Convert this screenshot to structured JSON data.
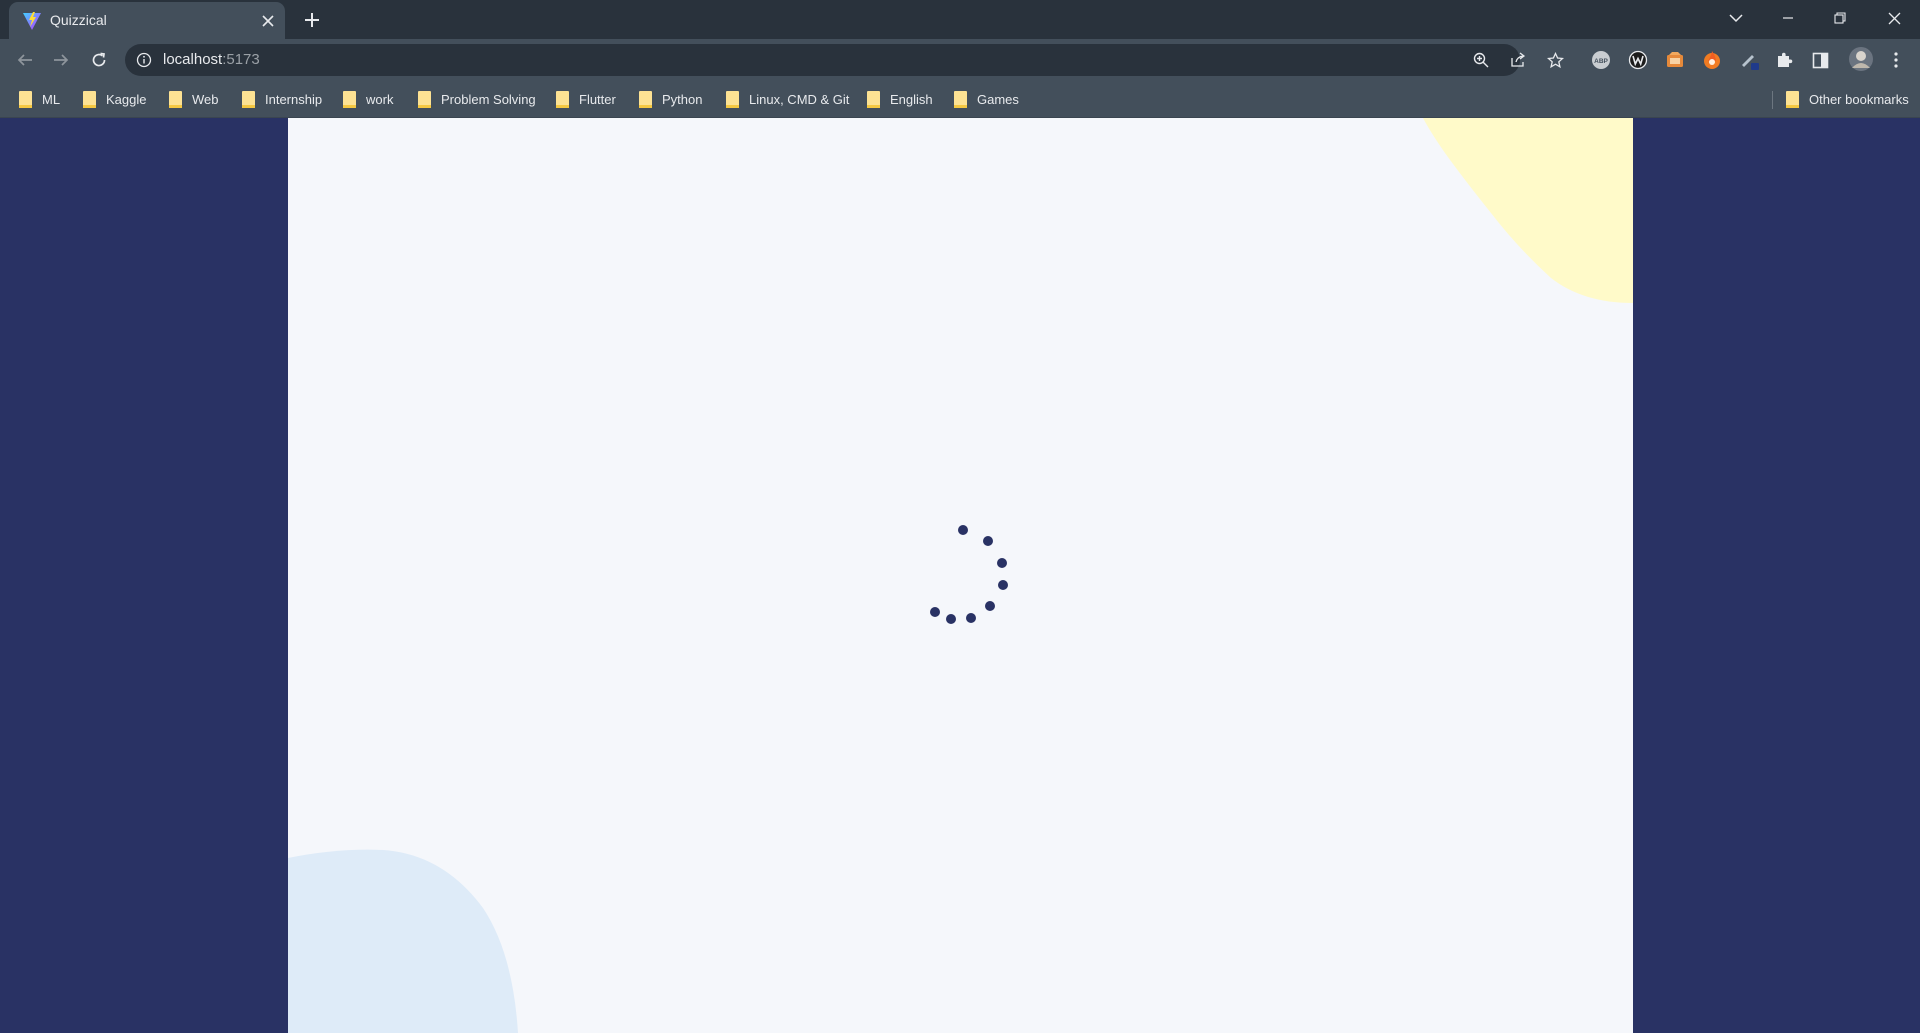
{
  "browser": {
    "tab": {
      "title": "Quizzical"
    },
    "address_bar": {
      "host": "localhost",
      "port": ":5173"
    },
    "bookmarks": [
      {
        "label": "ML"
      },
      {
        "label": "Kaggle"
      },
      {
        "label": "Web"
      },
      {
        "label": "Internship"
      },
      {
        "label": "work"
      },
      {
        "label": "Problem Solving"
      },
      {
        "label": "Flutter"
      },
      {
        "label": "Python"
      },
      {
        "label": "Linux, CMD & Git"
      },
      {
        "label": "English"
      },
      {
        "label": "Games"
      }
    ],
    "other_bookmarks_label": "Other bookmarks"
  },
  "page": {
    "background_color": "#293264",
    "card_color": "#f5f7fb",
    "blob_yellow_color": "#fffac9",
    "blob_blue_color": "#deebf8",
    "spinner_color": "#293264",
    "state": "loading"
  }
}
